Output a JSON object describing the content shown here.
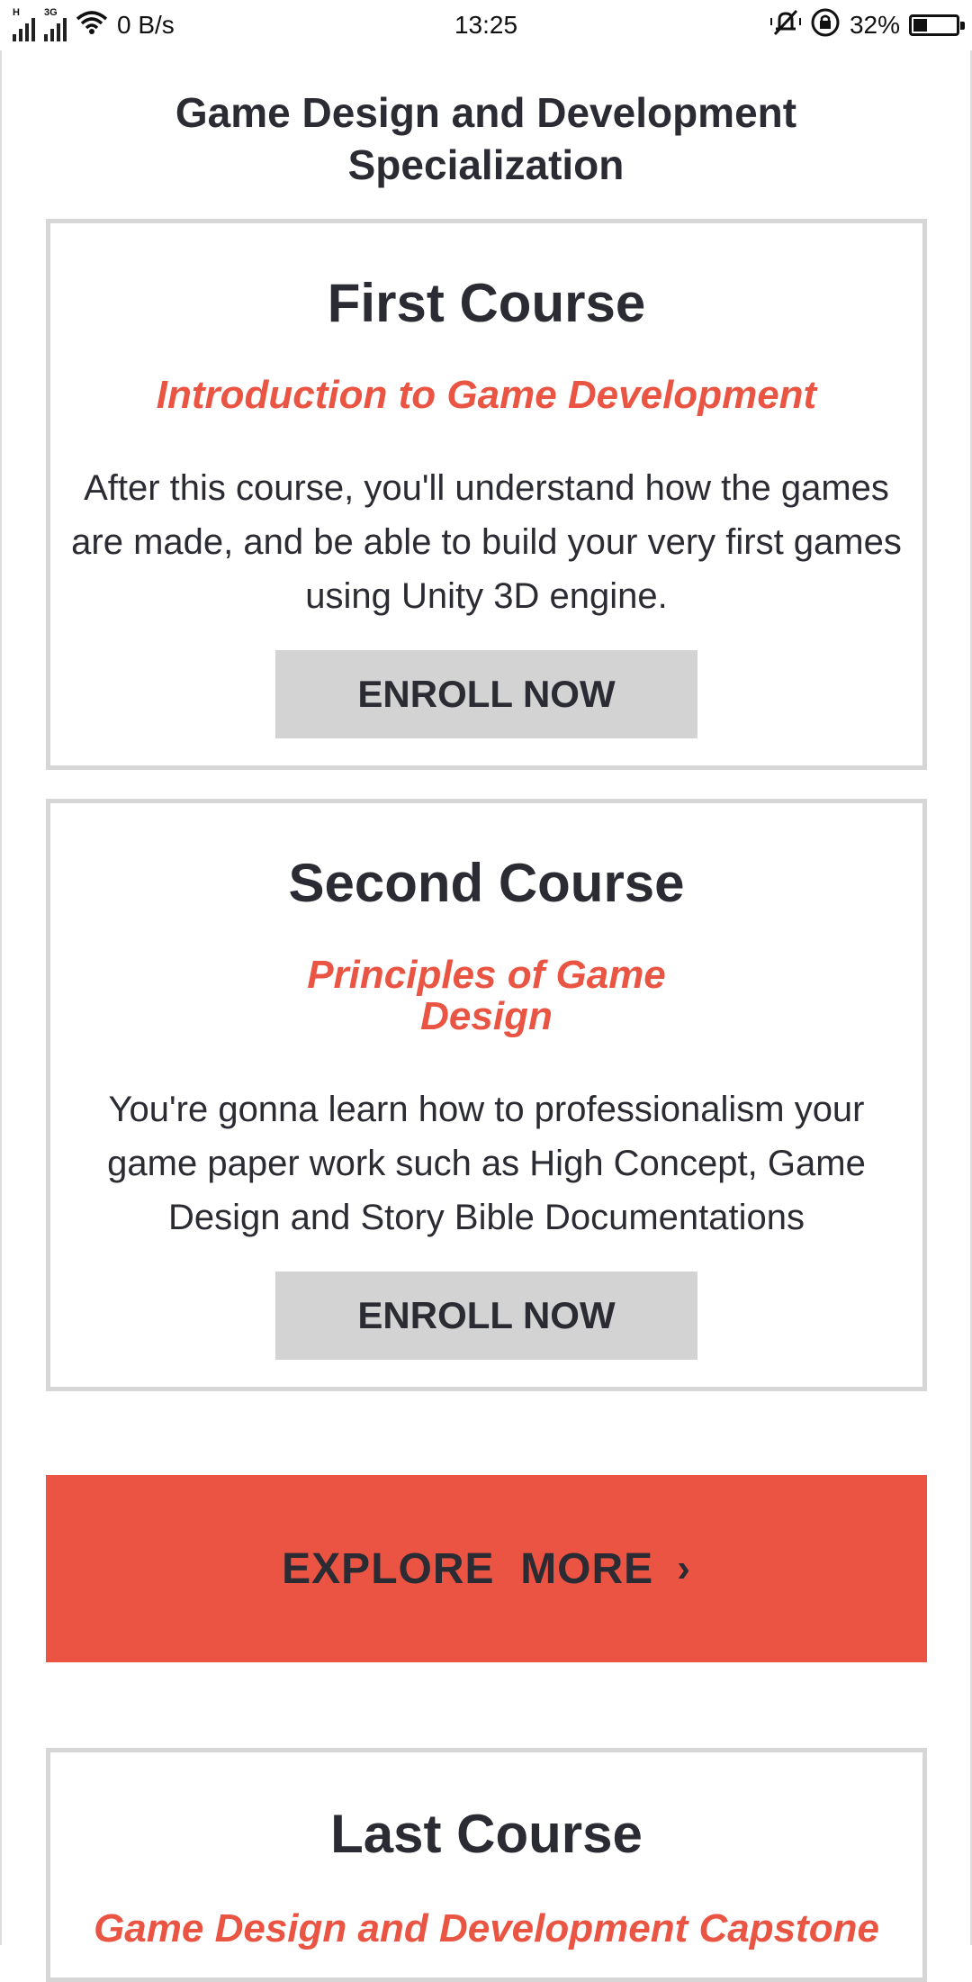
{
  "status_bar": {
    "network_speed": "0 B/s",
    "time": "13:25",
    "battery_percent": "32%",
    "battery_level": 0.32
  },
  "page": {
    "title_line1": "Game Design and Development",
    "title_line2": "Specialization"
  },
  "courses": [
    {
      "heading": "First Course",
      "subtitle_line1": "Introduction to Game Development",
      "subtitle_line2": "",
      "description": "After this course, you'll understand how the games are made, and be able to build your very first games using Unity 3D engine.",
      "button_label": "ENROLL NOW"
    },
    {
      "heading": "Second Course",
      "subtitle_line1": "Principles of Game",
      "subtitle_line2": "Design",
      "description": "You're gonna learn how to professionalism your game paper work such as High Concept, Game Design and Story Bible Documentations",
      "button_label": "ENROLL NOW"
    },
    {
      "heading": "Last Course",
      "subtitle_line1": "Game Design and Development Capstone",
      "subtitle_line2": ""
    }
  ],
  "explore": {
    "label": "EXPLORE  MORE",
    "chevron": "›"
  },
  "colors": {
    "accent": "#eb5443",
    "subtitle": "#e95443",
    "text": "#2b2b33",
    "button_bg": "#d3d3d3",
    "card_border": "#d6d6d6"
  }
}
